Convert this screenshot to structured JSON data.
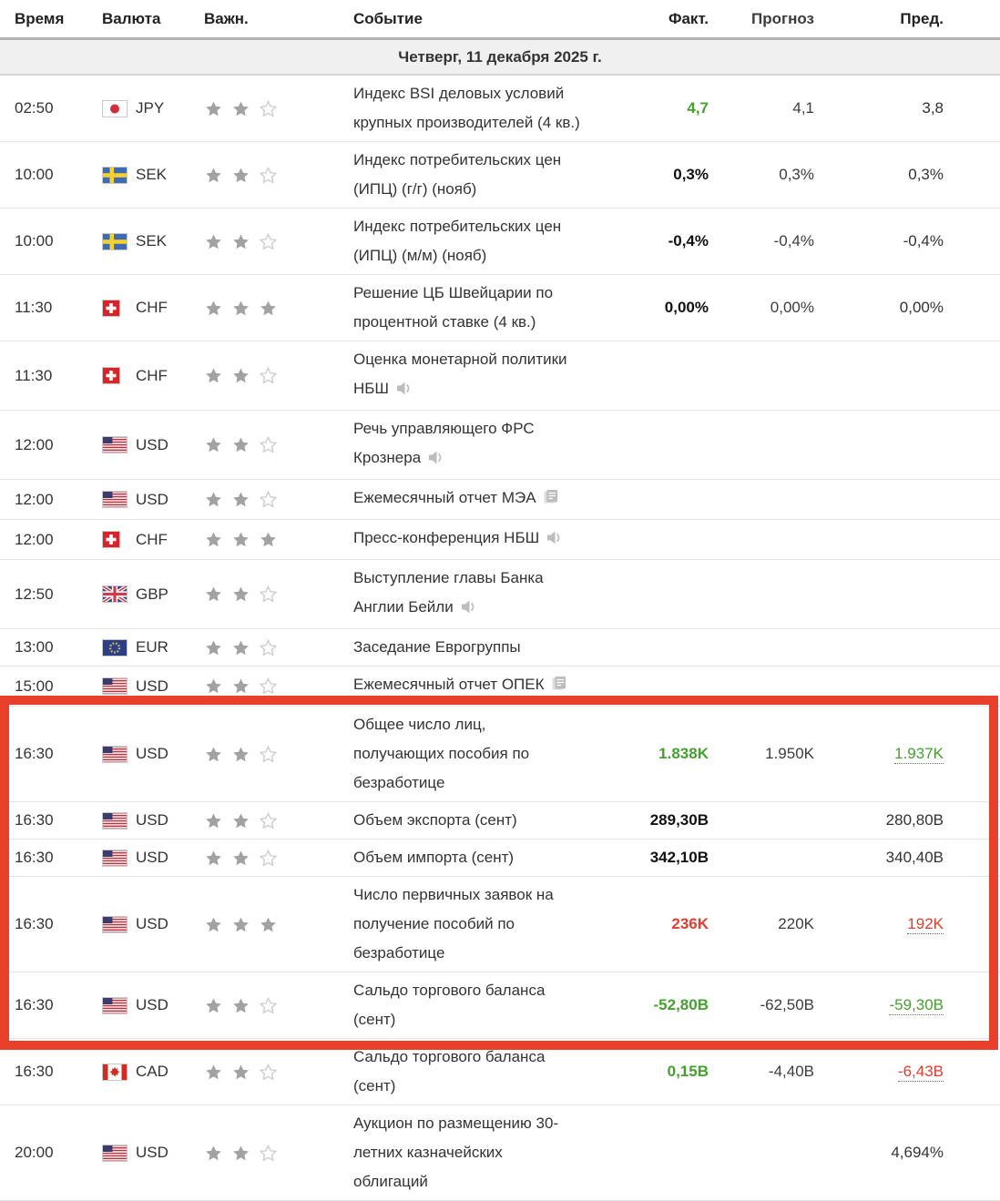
{
  "header": {
    "time": "Время",
    "currency": "Валюта",
    "importance": "Важн.",
    "event": "Событие",
    "actual": "Факт.",
    "forecast": "Прогноз",
    "previous": "Пред."
  },
  "date_header": "Четверг, 11 декабря 2025 г.",
  "colors": {
    "green": "#44a12e",
    "red": "#e23d2d",
    "highlight": "#e8402a",
    "star_filled": "#a2a2a2",
    "star_empty_outline": "#cdcdcd"
  },
  "rows": [
    {
      "time": "02:50",
      "currency": "JPY",
      "flag": "jpy",
      "stars": 2,
      "event": "Индекс BSI деловых условий\nкрупных производителей (4 кв.)",
      "icon": null,
      "actual": {
        "text": "4,7",
        "style": "green-bold"
      },
      "forecast": "4,1",
      "previous": {
        "text": "3,8",
        "style": "plain"
      }
    },
    {
      "time": "10:00",
      "currency": "SEK",
      "flag": "sek",
      "stars": 2,
      "event": "Индекс потребительских цен\n(ИПЦ) (г/г) (нояб)",
      "icon": null,
      "actual": {
        "text": "0,3%",
        "style": "bold"
      },
      "forecast": "0,3%",
      "previous": {
        "text": "0,3%",
        "style": "plain"
      }
    },
    {
      "time": "10:00",
      "currency": "SEK",
      "flag": "sek",
      "stars": 2,
      "event": "Индекс потребительских цен\n(ИПЦ) (м/м) (нояб)",
      "icon": null,
      "actual": {
        "text": "-0,4%",
        "style": "bold"
      },
      "forecast": "-0,4%",
      "previous": {
        "text": "-0,4%",
        "style": "plain"
      }
    },
    {
      "time": "11:30",
      "currency": "CHF",
      "flag": "chf",
      "stars": 3,
      "event": "Решение ЦБ Швейцарии по\nпроцентной ставке (4 кв.)",
      "icon": null,
      "actual": {
        "text": "0,00%",
        "style": "bold"
      },
      "forecast": "0,00%",
      "previous": {
        "text": "0,00%",
        "style": "plain"
      }
    },
    {
      "time": "11:30",
      "currency": "CHF",
      "flag": "chf",
      "stars": 2,
      "event": "Оценка монетарной политики\nНБШ",
      "icon": "speaker",
      "actual": null,
      "forecast": "",
      "previous": null
    },
    {
      "time": "12:00",
      "currency": "USD",
      "flag": "usd",
      "stars": 2,
      "event": "Речь управляющего ФРС\nКрознера",
      "icon": "speaker",
      "actual": null,
      "forecast": "",
      "previous": null
    },
    {
      "time": "12:00",
      "currency": "USD",
      "flag": "usd",
      "stars": 2,
      "event": "Ежемесячный отчет МЭА",
      "icon": "report",
      "actual": null,
      "forecast": "",
      "previous": null
    },
    {
      "time": "12:00",
      "currency": "CHF",
      "flag": "chf",
      "stars": 3,
      "event": "Пресс-конференция НБШ",
      "icon": "speaker",
      "actual": null,
      "forecast": "",
      "previous": null
    },
    {
      "time": "12:50",
      "currency": "GBP",
      "flag": "gbp",
      "stars": 2,
      "event": "Выступление главы Банка\nАнглии Бейли",
      "icon": "speaker",
      "actual": null,
      "forecast": "",
      "previous": null
    },
    {
      "time": "13:00",
      "currency": "EUR",
      "flag": "eur",
      "stars": 2,
      "event": "Заседание Еврогруппы",
      "icon": null,
      "actual": null,
      "forecast": "",
      "previous": null
    },
    {
      "time": "15:00",
      "currency": "USD",
      "flag": "usd",
      "stars": 2,
      "event": "Ежемесячный отчет ОПЕК",
      "icon": "report",
      "actual": null,
      "forecast": "",
      "previous": null
    },
    {
      "time": "16:30",
      "currency": "USD",
      "flag": "usd",
      "stars": 2,
      "event": "Общее число лиц,\nполучающих пособия по\nбезработице",
      "icon": null,
      "actual": {
        "text": "1.838K",
        "style": "green-bold"
      },
      "forecast": "1.950K",
      "previous": {
        "text": "1.937K",
        "style": "green-link"
      }
    },
    {
      "time": "16:30",
      "currency": "USD",
      "flag": "usd",
      "stars": 2,
      "event": "Объем экспорта (сент)",
      "icon": null,
      "actual": {
        "text": "289,30B",
        "style": "bold"
      },
      "forecast": "",
      "previous": {
        "text": "280,80B",
        "style": "plain"
      }
    },
    {
      "time": "16:30",
      "currency": "USD",
      "flag": "usd",
      "stars": 2,
      "event": "Объем импорта (сент)",
      "icon": null,
      "actual": {
        "text": "342,10B",
        "style": "bold"
      },
      "forecast": "",
      "previous": {
        "text": "340,40B",
        "style": "plain"
      }
    },
    {
      "time": "16:30",
      "currency": "USD",
      "flag": "usd",
      "stars": 3,
      "event": "Число первичных заявок на\nполучение пособий по\nбезработице",
      "icon": null,
      "actual": {
        "text": "236K",
        "style": "red-bold"
      },
      "forecast": "220K",
      "previous": {
        "text": "192K",
        "style": "red-link"
      }
    },
    {
      "time": "16:30",
      "currency": "USD",
      "flag": "usd",
      "stars": 2,
      "event": "Сальдо торгового баланса\n(сент)",
      "icon": null,
      "actual": {
        "text": "-52,80B",
        "style": "green-bold"
      },
      "forecast": "-62,50B",
      "previous": {
        "text": "-59,30B",
        "style": "green-link"
      }
    },
    {
      "time": "16:30",
      "currency": "CAD",
      "flag": "cad",
      "stars": 2,
      "event": "Сальдо торгового баланса\n(сент)",
      "icon": null,
      "actual": {
        "text": "0,15B",
        "style": "green-bold"
      },
      "forecast": "-4,40B",
      "previous": {
        "text": "-6,43B",
        "style": "red-link"
      }
    },
    {
      "time": "20:00",
      "currency": "USD",
      "flag": "usd",
      "stars": 2,
      "event": "Аукцион по размещению 30-\nлетних казначейских\nоблигаций",
      "icon": null,
      "actual": null,
      "forecast": "",
      "previous": {
        "text": "4,694%",
        "style": "plain"
      }
    }
  ],
  "highlight": {
    "from_index": 11,
    "to_index": 15
  }
}
